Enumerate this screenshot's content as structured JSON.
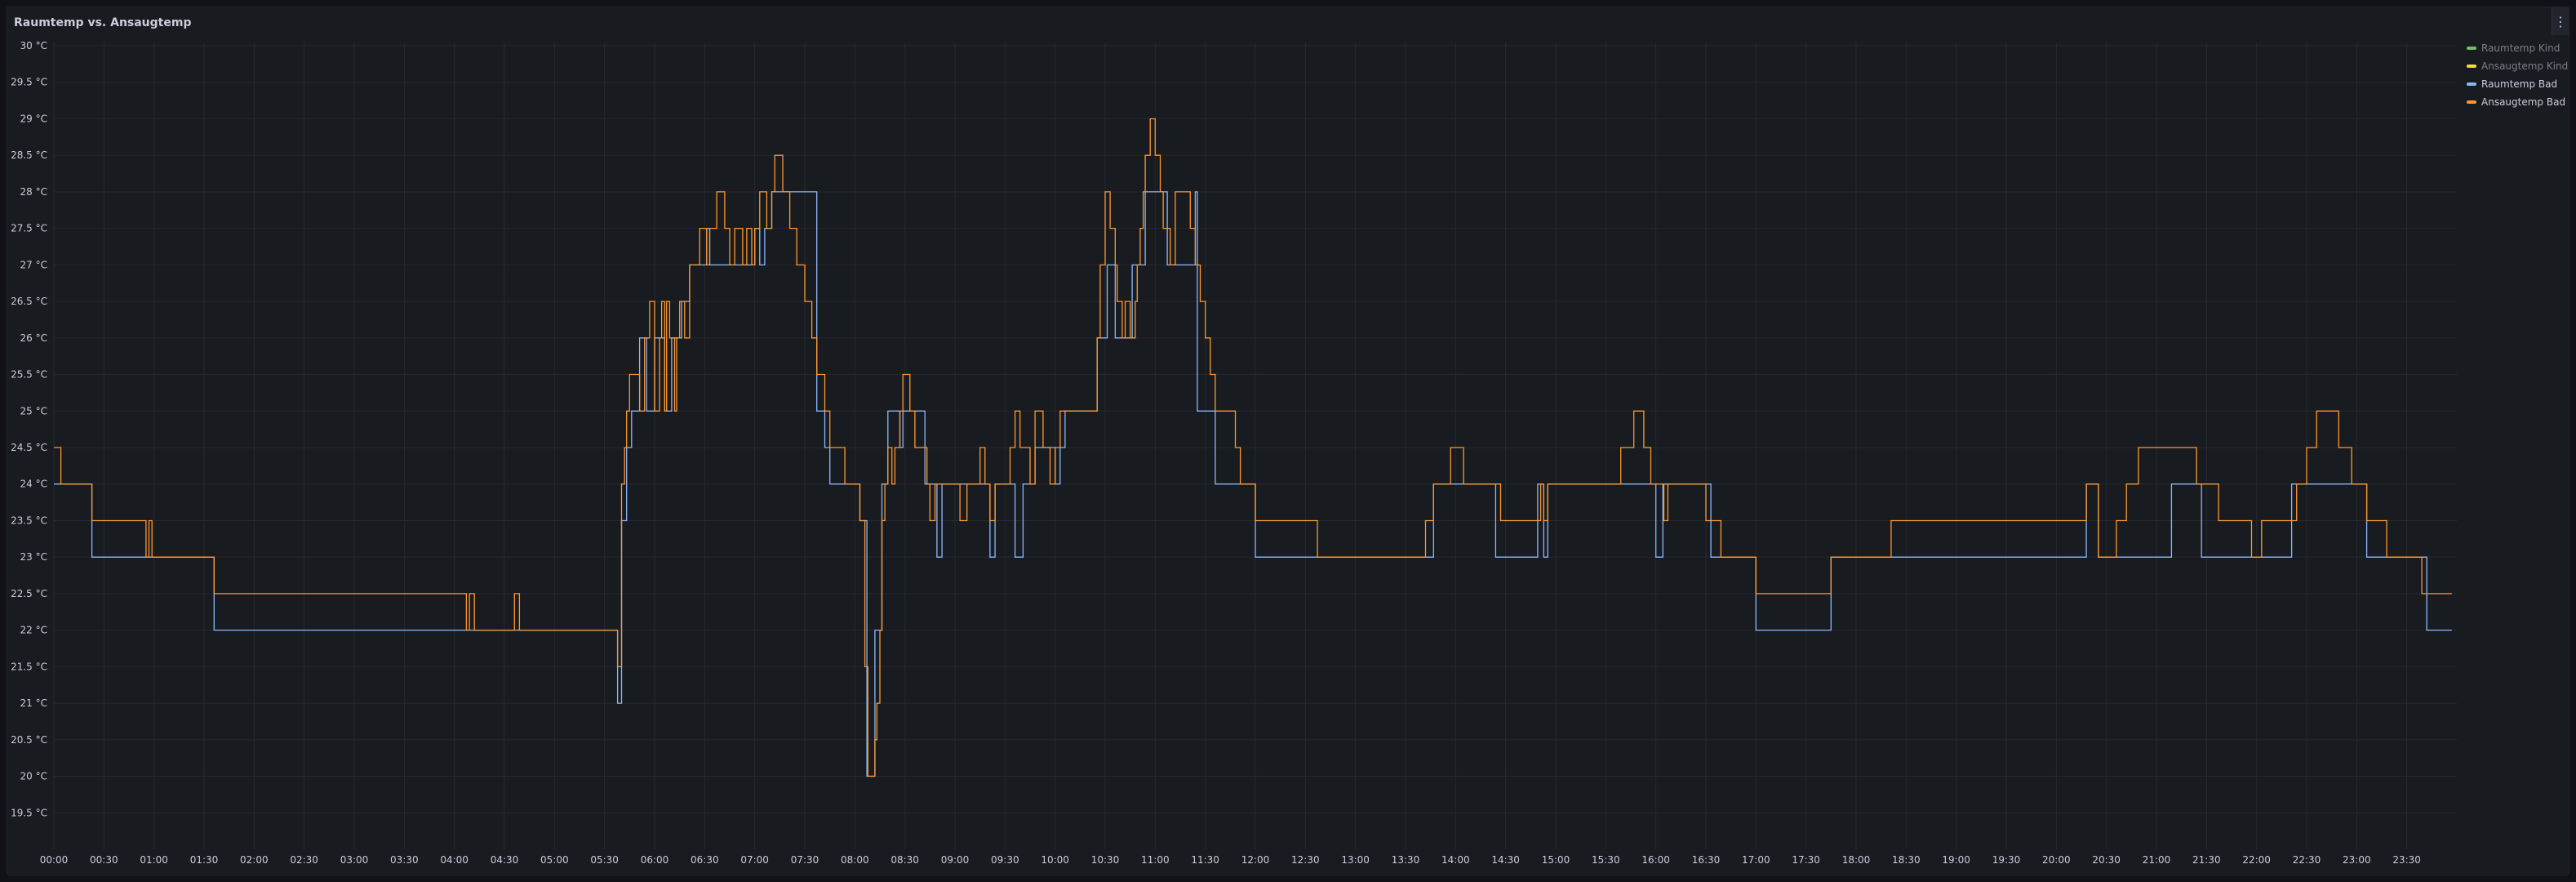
{
  "panel": {
    "title": "Raumtemp vs. Ansaugtemp",
    "menu_icon": "⋮"
  },
  "legend": {
    "placement": "top-right",
    "items": [
      {
        "label": "Raumtemp Kind",
        "color": "#73bf69",
        "hidden": true
      },
      {
        "label": "Ansaugtemp Kind",
        "color": "#fade2a",
        "hidden": true
      },
      {
        "label": "Raumtemp Bad",
        "color": "#8ab8ff",
        "hidden": false
      },
      {
        "label": "Ansaugtemp Bad",
        "color": "#ff9830",
        "hidden": false
      }
    ]
  },
  "chart_data": {
    "type": "line",
    "title": "Raumtemp vs. Ansaugtemp",
    "xlabel": "",
    "ylabel": "",
    "grid": true,
    "line_style": "step",
    "xlim": [
      0,
      24
    ],
    "ylim": [
      19,
      30
    ],
    "y_ticks": [
      "19.5 °C",
      "20 °C",
      "20.5 °C",
      "21 °C",
      "21.5 °C",
      "22 °C",
      "22.5 °C",
      "23 °C",
      "23.5 °C",
      "24 °C",
      "24.5 °C",
      "25 °C",
      "25.5 °C",
      "26 °C",
      "26.5 °C",
      "27 °C",
      "27.5 °C",
      "28 °C",
      "28.5 °C",
      "29 °C",
      "29.5 °C",
      "30 °C"
    ],
    "x_ticks": [
      "00:00",
      "00:30",
      "01:00",
      "01:30",
      "02:00",
      "02:30",
      "03:00",
      "03:30",
      "04:00",
      "04:30",
      "05:00",
      "05:30",
      "06:00",
      "06:30",
      "07:00",
      "07:30",
      "08:00",
      "08:30",
      "09:00",
      "09:30",
      "10:00",
      "10:30",
      "11:00",
      "11:30",
      "12:00",
      "12:30",
      "13:00",
      "13:30",
      "14:00",
      "14:30",
      "15:00",
      "15:30",
      "16:00",
      "16:30",
      "17:00",
      "17:30",
      "18:00",
      "18:30",
      "19:00",
      "19:30",
      "20:00",
      "20:30",
      "21:00",
      "21:30",
      "22:00",
      "22:30",
      "23:00",
      "23:30"
    ],
    "series": [
      {
        "name": "Raumtemp Bad",
        "color": "#8ab8ff",
        "points": [
          [
            0.0,
            24
          ],
          [
            0.38,
            23
          ],
          [
            1.6,
            22
          ],
          [
            5.6,
            22
          ],
          [
            5.63,
            21
          ],
          [
            5.67,
            23.5
          ],
          [
            5.72,
            24.5
          ],
          [
            5.77,
            25
          ],
          [
            5.85,
            26
          ],
          [
            5.92,
            25
          ],
          [
            6.0,
            26
          ],
          [
            6.1,
            25
          ],
          [
            6.17,
            26
          ],
          [
            6.27,
            26.5
          ],
          [
            6.35,
            27
          ],
          [
            6.52,
            27.5
          ],
          [
            6.55,
            27
          ],
          [
            7.0,
            27.5
          ],
          [
            7.05,
            27
          ],
          [
            7.1,
            27.5
          ],
          [
            7.17,
            28
          ],
          [
            7.62,
            25
          ],
          [
            7.7,
            24.5
          ],
          [
            7.75,
            24
          ],
          [
            8.05,
            23.5
          ],
          [
            8.12,
            20
          ],
          [
            8.2,
            22
          ],
          [
            8.27,
            24
          ],
          [
            8.33,
            25
          ],
          [
            8.45,
            24.5
          ],
          [
            8.48,
            25
          ],
          [
            8.7,
            24
          ],
          [
            8.82,
            23
          ],
          [
            8.87,
            24
          ],
          [
            9.05,
            24
          ],
          [
            9.35,
            23
          ],
          [
            9.4,
            24
          ],
          [
            9.6,
            23
          ],
          [
            9.68,
            24
          ],
          [
            9.8,
            24.5
          ],
          [
            10.0,
            24
          ],
          [
            10.05,
            24.5
          ],
          [
            10.1,
            25
          ],
          [
            10.42,
            26
          ],
          [
            10.52,
            27
          ],
          [
            10.6,
            26
          ],
          [
            10.75,
            26
          ],
          [
            10.77,
            27
          ],
          [
            10.9,
            28
          ],
          [
            11.12,
            27
          ],
          [
            11.4,
            28
          ],
          [
            11.42,
            25
          ],
          [
            11.6,
            24
          ],
          [
            11.65,
            24
          ],
          [
            12.0,
            23
          ],
          [
            13.5,
            23
          ],
          [
            13.78,
            24
          ],
          [
            14.4,
            23
          ],
          [
            14.82,
            24
          ],
          [
            14.88,
            23
          ],
          [
            14.92,
            24
          ],
          [
            16.0,
            23
          ],
          [
            16.07,
            24
          ],
          [
            16.55,
            23
          ],
          [
            17.0,
            22
          ],
          [
            17.75,
            23
          ],
          [
            20.3,
            24
          ],
          [
            20.42,
            23
          ],
          [
            21.15,
            24
          ],
          [
            21.45,
            23
          ],
          [
            22.35,
            24
          ],
          [
            23.1,
            23
          ],
          [
            23.7,
            22
          ],
          [
            23.95,
            22
          ]
        ]
      },
      {
        "name": "Ansaugtemp Bad",
        "color": "#ff9830",
        "points": [
          [
            0.0,
            24.5
          ],
          [
            0.07,
            24
          ],
          [
            0.38,
            23.5
          ],
          [
            0.92,
            23
          ],
          [
            0.95,
            23.5
          ],
          [
            0.98,
            23
          ],
          [
            1.6,
            22.5
          ],
          [
            4.12,
            22
          ],
          [
            4.15,
            22.5
          ],
          [
            4.2,
            22
          ],
          [
            4.6,
            22.5
          ],
          [
            4.65,
            22
          ],
          [
            5.6,
            22
          ],
          [
            5.63,
            21.5
          ],
          [
            5.67,
            24
          ],
          [
            5.7,
            24.5
          ],
          [
            5.72,
            25
          ],
          [
            5.75,
            25.5
          ],
          [
            5.85,
            25
          ],
          [
            5.9,
            26
          ],
          [
            5.95,
            26.5
          ],
          [
            6.0,
            25
          ],
          [
            6.05,
            26
          ],
          [
            6.07,
            26.5
          ],
          [
            6.1,
            25
          ],
          [
            6.12,
            26.5
          ],
          [
            6.15,
            26
          ],
          [
            6.2,
            25
          ],
          [
            6.22,
            26
          ],
          [
            6.25,
            26.5
          ],
          [
            6.3,
            26
          ],
          [
            6.35,
            27
          ],
          [
            6.45,
            27.5
          ],
          [
            6.52,
            27
          ],
          [
            6.55,
            27.5
          ],
          [
            6.62,
            28
          ],
          [
            6.68,
            28
          ],
          [
            6.7,
            27.5
          ],
          [
            6.75,
            27
          ],
          [
            6.8,
            27.5
          ],
          [
            6.88,
            27
          ],
          [
            6.92,
            27.5
          ],
          [
            6.97,
            27
          ],
          [
            7.0,
            27.5
          ],
          [
            7.05,
            28
          ],
          [
            7.12,
            27.5
          ],
          [
            7.17,
            28
          ],
          [
            7.2,
            28.5
          ],
          [
            7.28,
            28
          ],
          [
            7.35,
            27.5
          ],
          [
            7.42,
            27
          ],
          [
            7.5,
            26.5
          ],
          [
            7.57,
            26
          ],
          [
            7.62,
            25.5
          ],
          [
            7.7,
            25
          ],
          [
            7.75,
            24.5
          ],
          [
            7.85,
            24.5
          ],
          [
            7.9,
            24
          ],
          [
            8.05,
            23.5
          ],
          [
            8.1,
            21.5
          ],
          [
            8.13,
            20
          ],
          [
            8.2,
            20.5
          ],
          [
            8.22,
            21
          ],
          [
            8.25,
            22
          ],
          [
            8.27,
            23.5
          ],
          [
            8.3,
            24
          ],
          [
            8.33,
            24.5
          ],
          [
            8.37,
            24
          ],
          [
            8.4,
            24.5
          ],
          [
            8.45,
            25
          ],
          [
            8.48,
            25.5
          ],
          [
            8.55,
            25
          ],
          [
            8.6,
            24.5
          ],
          [
            8.72,
            24
          ],
          [
            8.75,
            23.5
          ],
          [
            8.8,
            24
          ],
          [
            9.05,
            23.5
          ],
          [
            9.12,
            24
          ],
          [
            9.25,
            24.5
          ],
          [
            9.3,
            24
          ],
          [
            9.35,
            23.5
          ],
          [
            9.4,
            24
          ],
          [
            9.55,
            24.5
          ],
          [
            9.6,
            25
          ],
          [
            9.65,
            24.5
          ],
          [
            9.75,
            24
          ],
          [
            9.8,
            25
          ],
          [
            9.88,
            24.5
          ],
          [
            9.95,
            24
          ],
          [
            10.0,
            24.5
          ],
          [
            10.05,
            25
          ],
          [
            10.42,
            26
          ],
          [
            10.45,
            27
          ],
          [
            10.5,
            28
          ],
          [
            10.55,
            27.5
          ],
          [
            10.6,
            27
          ],
          [
            10.62,
            26.5
          ],
          [
            10.67,
            26
          ],
          [
            10.7,
            26.5
          ],
          [
            10.75,
            26
          ],
          [
            10.8,
            26.5
          ],
          [
            10.82,
            27
          ],
          [
            10.85,
            27.5
          ],
          [
            10.88,
            28
          ],
          [
            10.9,
            28.5
          ],
          [
            10.95,
            29
          ],
          [
            11.0,
            28.5
          ],
          [
            11.05,
            28
          ],
          [
            11.08,
            27.5
          ],
          [
            11.15,
            27
          ],
          [
            11.2,
            28
          ],
          [
            11.35,
            27.5
          ],
          [
            11.4,
            27
          ],
          [
            11.45,
            26.5
          ],
          [
            11.5,
            26
          ],
          [
            11.55,
            25.5
          ],
          [
            11.6,
            25
          ],
          [
            11.8,
            24.5
          ],
          [
            11.85,
            24
          ],
          [
            12.0,
            23.5
          ],
          [
            12.6,
            23.5
          ],
          [
            12.62,
            23
          ],
          [
            13.5,
            23
          ],
          [
            13.7,
            23.5
          ],
          [
            13.78,
            24
          ],
          [
            13.95,
            24.5
          ],
          [
            14.08,
            24
          ],
          [
            14.45,
            23.5
          ],
          [
            14.85,
            24
          ],
          [
            14.88,
            23.5
          ],
          [
            14.92,
            24
          ],
          [
            15.65,
            24.5
          ],
          [
            15.78,
            25
          ],
          [
            15.88,
            24.5
          ],
          [
            15.95,
            24
          ],
          [
            16.08,
            23.5
          ],
          [
            16.12,
            24
          ],
          [
            16.5,
            23.5
          ],
          [
            16.65,
            23
          ],
          [
            17.0,
            22.5
          ],
          [
            17.75,
            23
          ],
          [
            18.35,
            23.5
          ],
          [
            20.3,
            24
          ],
          [
            20.42,
            23
          ],
          [
            20.6,
            23.5
          ],
          [
            20.7,
            24
          ],
          [
            20.78,
            24
          ],
          [
            20.82,
            24.5
          ],
          [
            21.4,
            24
          ],
          [
            21.62,
            23.5
          ],
          [
            21.95,
            23
          ],
          [
            22.05,
            23.5
          ],
          [
            22.4,
            24
          ],
          [
            22.5,
            24.5
          ],
          [
            22.6,
            25
          ],
          [
            22.82,
            24.5
          ],
          [
            22.95,
            24
          ],
          [
            23.1,
            23.5
          ],
          [
            23.3,
            23
          ],
          [
            23.65,
            22.5
          ],
          [
            23.95,
            22.5
          ]
        ]
      }
    ]
  }
}
